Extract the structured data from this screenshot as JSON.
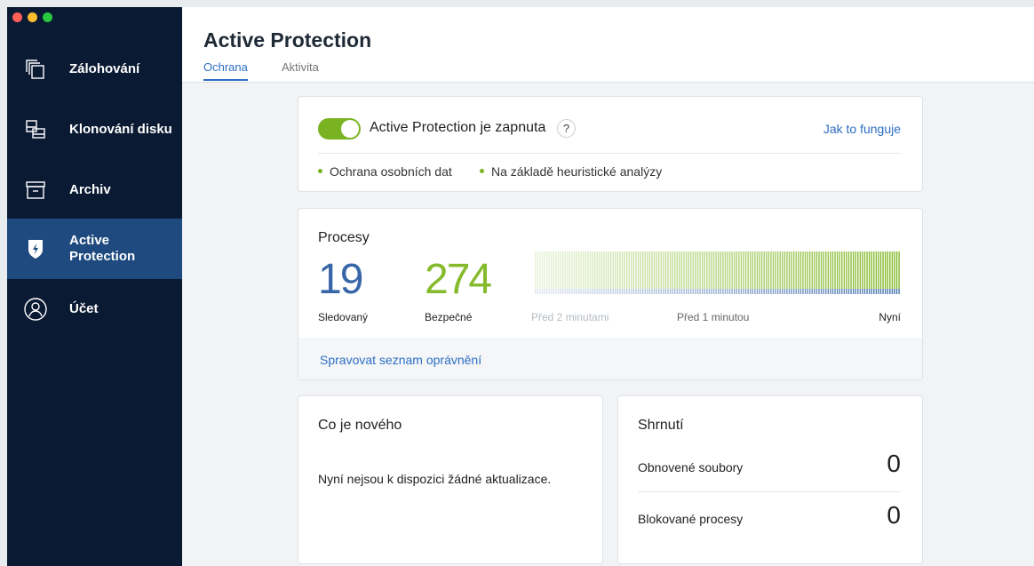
{
  "sidebar": {
    "items": [
      {
        "label": "Zálohování",
        "icon": "copy-icon"
      },
      {
        "label": "Klonování disku",
        "icon": "clone-disk-icon"
      },
      {
        "label": "Archiv",
        "icon": "archive-icon"
      },
      {
        "label": "Active\nProtection",
        "icon": "shield-icon"
      },
      {
        "label": "Účet",
        "icon": "user-icon"
      }
    ]
  },
  "header": {
    "title": "Active Protection",
    "tabs": [
      "Ochrana",
      "Aktivita"
    ]
  },
  "protection": {
    "status_label": "Active Protection je zapnuta",
    "help": "?",
    "how_link": "Jak to funguje",
    "features": [
      "Ochrana osobních dat",
      "Na základě heuristické analýzy"
    ],
    "toggle_on": true,
    "accent_color": "#7ab322"
  },
  "processes": {
    "title": "Procesy",
    "monitored_count": "19",
    "monitored_label": "Sledovaný",
    "safe_count": "274",
    "safe_label": "Bezpečné",
    "time_labels": [
      "Před 2 minutami",
      "Před 1 minutou",
      "Nyní"
    ],
    "manage_link": "Spravovat seznam oprávnění"
  },
  "news": {
    "title": "Co je nového",
    "text": "Nyní nejsou k dispozici žádné aktualizace."
  },
  "summary": {
    "title": "Shrnutí",
    "rows": [
      {
        "label": "Obnovené soubory",
        "value": "0"
      },
      {
        "label": "Blokované procesy",
        "value": "0"
      }
    ]
  }
}
